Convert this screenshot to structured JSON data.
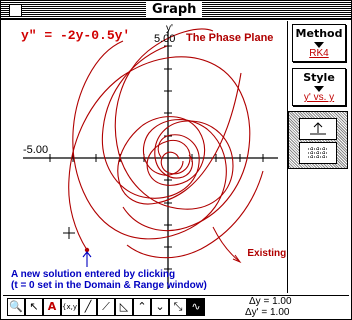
{
  "window": {
    "title": "Graph"
  },
  "equation": "y\" =  -2y-0.5y'",
  "plot": {
    "axes": {
      "y_label": "y'",
      "y_max_label": "5.00",
      "x_min_label": "-5.00"
    },
    "annotations": {
      "phase_plane": "The Phase Plane",
      "existing": "Existing Solutions",
      "new_solution_line1": "A new solution entered by clicking",
      "new_solution_line2": "(t = 0 set in the Domain & Range window)"
    }
  },
  "side": {
    "method": {
      "label": "Method",
      "value": "RK4"
    },
    "style": {
      "label": "Style",
      "value": "y' vs. y"
    }
  },
  "toolbar": {
    "tools": [
      {
        "name": "zoom-tool",
        "glyph": "🔍"
      },
      {
        "name": "arrow-tool",
        "glyph": "↖"
      },
      {
        "name": "text-tool",
        "glyph": "A"
      },
      {
        "name": "xy-tool",
        "glyph": "{x,y}"
      },
      {
        "name": "line-tool",
        "glyph": "╱"
      },
      {
        "name": "tangent-tool",
        "glyph": "⟋"
      },
      {
        "name": "area-tool",
        "glyph": "◺"
      },
      {
        "name": "max-tool",
        "glyph": "⌃"
      },
      {
        "name": "min-tool",
        "glyph": "⌄"
      },
      {
        "name": "slope-tool",
        "glyph": "⤡"
      },
      {
        "name": "field-tool",
        "glyph": "∿"
      }
    ],
    "delta_y": "Δy = 1.00",
    "delta_yp": "Δy' = 1.00"
  },
  "colors": {
    "curve": "#b00000",
    "equation": "#d00000",
    "note": "#0000c0"
  }
}
